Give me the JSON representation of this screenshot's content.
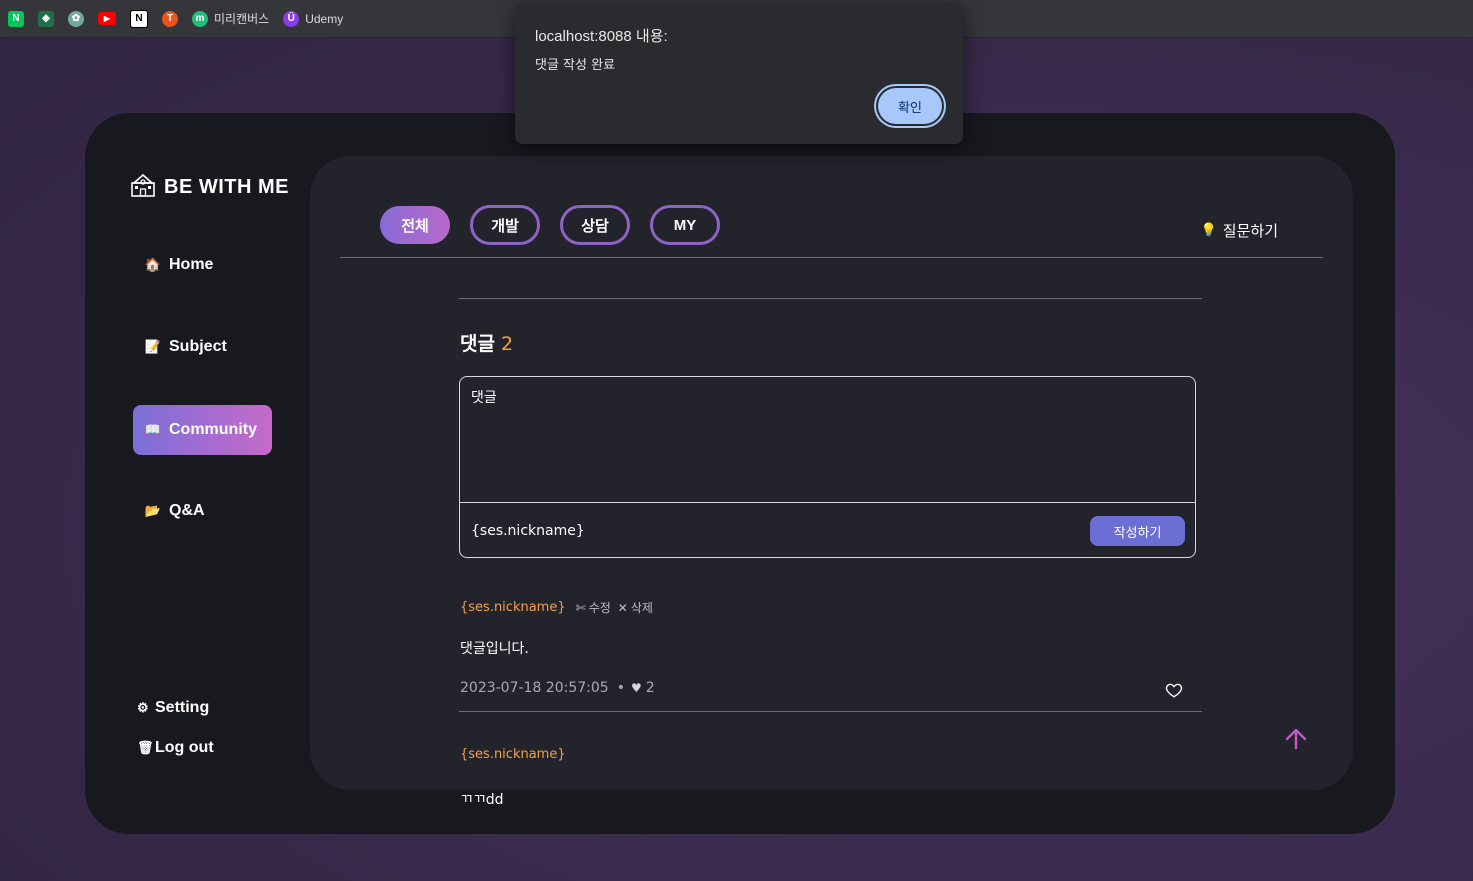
{
  "bookmarks": [
    {
      "icon": "naver-icon",
      "glyph": "N",
      "color": "#03c75a",
      "label": ""
    },
    {
      "icon": "gitmind-icon",
      "glyph": "◈",
      "color": "#1f6f4a",
      "label": ""
    },
    {
      "icon": "openai-icon",
      "glyph": "✿",
      "color": "#74aa9c",
      "label": ""
    },
    {
      "icon": "youtube-icon",
      "glyph": "▶",
      "color": "#ff0000",
      "label": ""
    },
    {
      "icon": "notion-icon",
      "glyph": "N",
      "color": "#ffffff",
      "label": ""
    },
    {
      "icon": "tistory-icon",
      "glyph": "T",
      "color": "#eb531f",
      "label": ""
    },
    {
      "icon": "miricanvas-icon",
      "glyph": "m",
      "color": "#1fbf7a",
      "label": "미리캔버스"
    },
    {
      "icon": "udemy-icon",
      "glyph": "Ü",
      "color": "#8b3ce6",
      "label": "Udemy"
    }
  ],
  "sidebar": {
    "brand": "BE WITH ME",
    "items": [
      {
        "label": "Home",
        "icon": "house-icon",
        "glyph": "🏠",
        "active": false
      },
      {
        "label": "Subject",
        "icon": "memo-icon",
        "glyph": "📝",
        "active": false
      },
      {
        "label": "Community",
        "icon": "book-icon",
        "glyph": "📖",
        "active": true
      },
      {
        "label": "Q&A",
        "icon": "folder-icon",
        "glyph": "📂",
        "active": false
      }
    ],
    "setting": "Setting",
    "logout": "Log out"
  },
  "tabs": [
    {
      "label": "전체",
      "active": true
    },
    {
      "label": "개발",
      "active": false
    },
    {
      "label": "상담",
      "active": false
    },
    {
      "label": "MY",
      "active": false
    }
  ],
  "ask_label": "질문하기",
  "comments_section": {
    "title": "댓글",
    "count": "2",
    "placeholder": "댓글",
    "nickname": "{ses.nickname}",
    "submit_label": "작성하기"
  },
  "comments": [
    {
      "author": "{ses.nickname}",
      "edit_label": "수정",
      "delete_label": "삭제",
      "body": "댓글입니다.",
      "date": "2023-07-18 20:57:05",
      "likes": "2"
    },
    {
      "author": "{ses.nickname}",
      "body": "ㄲㄲdd"
    }
  ],
  "dialog": {
    "title": "localhost:8088 내용:",
    "message": "댓글 작성 완료",
    "ok_label": "확인"
  },
  "colors": {
    "accent_orange": "#f0a24a",
    "accent_purple": "#8e63c6",
    "submit_blue": "#6b6ed2",
    "ok_blue": "#a8c7fa"
  }
}
